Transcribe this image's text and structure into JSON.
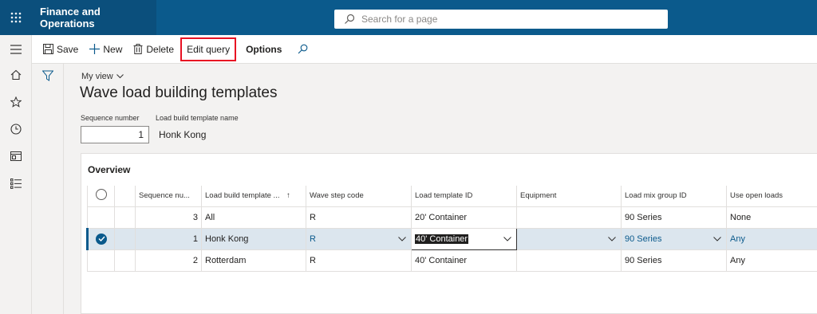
{
  "header": {
    "app_title": "Finance and Operations",
    "search_placeholder": "Search for a page"
  },
  "nav_rail": [
    "hamburger-icon",
    "home-icon",
    "star-icon",
    "clock-icon",
    "workspace-icon",
    "list-icon"
  ],
  "toolbar": {
    "save": "Save",
    "new": "New",
    "delete": "Delete",
    "edit_query": "Edit query",
    "options": "Options"
  },
  "page": {
    "view_label": "My view",
    "title": "Wave load building templates",
    "fields": {
      "sequence_label": "Sequence number",
      "sequence_value": "1",
      "name_label": "Load build template name",
      "name_value": "Honk Kong"
    }
  },
  "overview": {
    "title": "Overview",
    "columns": [
      "Sequence nu...",
      "Load build template ...",
      "Wave step code",
      "Load template ID",
      "Equipment",
      "Load mix group ID",
      "Use open loads"
    ],
    "sort_indicator": "↑",
    "rows": [
      {
        "seq": "3",
        "name": "All",
        "wave": "R",
        "template": "20' Container",
        "equipment": "",
        "mix": "90 Series",
        "open": "None",
        "selected": false
      },
      {
        "seq": "1",
        "name": "Honk Kong",
        "wave": "R",
        "template": "40' Container",
        "equipment": "",
        "mix": "90 Series",
        "open": "Any",
        "selected": true
      },
      {
        "seq": "2",
        "name": "Rotterdam",
        "wave": "R",
        "template": "40' Container",
        "equipment": "",
        "mix": "90 Series",
        "open": "Any",
        "selected": false
      }
    ]
  },
  "colors": {
    "brand": "#0b5a8c",
    "highlight_border": "#e81123",
    "selected_row": "#dce6ee"
  }
}
